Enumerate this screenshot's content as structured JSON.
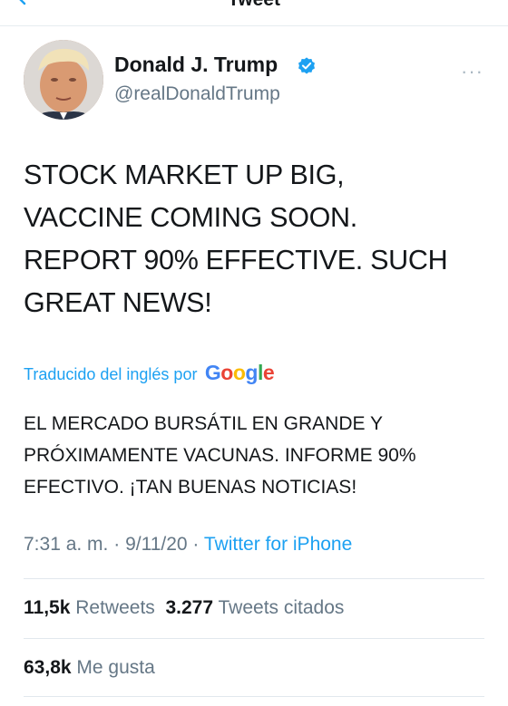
{
  "header": {
    "title": "Tweet",
    "back_icon": "chevron-left-icon"
  },
  "author": {
    "name": "Donald J. Trump",
    "handle": "@realDonaldTrump",
    "verified_icon": "verified-badge-icon",
    "more_icon": "more-options-icon",
    "more_glyph": "···"
  },
  "tweet": {
    "lines": [
      "STOCK MARKET UP BIG,",
      "VACCINE COMING SOON.",
      "REPORT 90% EFFECTIVE. SUCH",
      "GREAT NEWS!"
    ]
  },
  "translation": {
    "label": "Traducido del inglés por",
    "provider_letters": [
      "G",
      "o",
      "o",
      "g",
      "l",
      "e"
    ],
    "provider_colors": [
      "#4285f4",
      "#ea4335",
      "#fbbc05",
      "#4285f4",
      "#34a853",
      "#ea4335"
    ],
    "lines": [
      "EL MERCADO BURSÁTIL EN GRANDE Y",
      "PRÓXIMAMENTE VACUNAS. INFORME 90%",
      "EFECTIVO. ¡TAN BUENAS NOTICIAS!"
    ]
  },
  "meta": {
    "time": "7:31 a. m.",
    "separator": " · ",
    "date": "9/11/20",
    "source": "Twitter for iPhone"
  },
  "stats": {
    "retweets_count": "11,5k",
    "retweets_label": "Retweets",
    "quotes_count": "3.277",
    "quotes_label": "Tweets citados",
    "likes_count": "63,8k",
    "likes_label": "Me gusta"
  },
  "colors": {
    "accent": "#1da1f2",
    "secondary_text": "#657786",
    "divider": "#e1e8ed"
  }
}
